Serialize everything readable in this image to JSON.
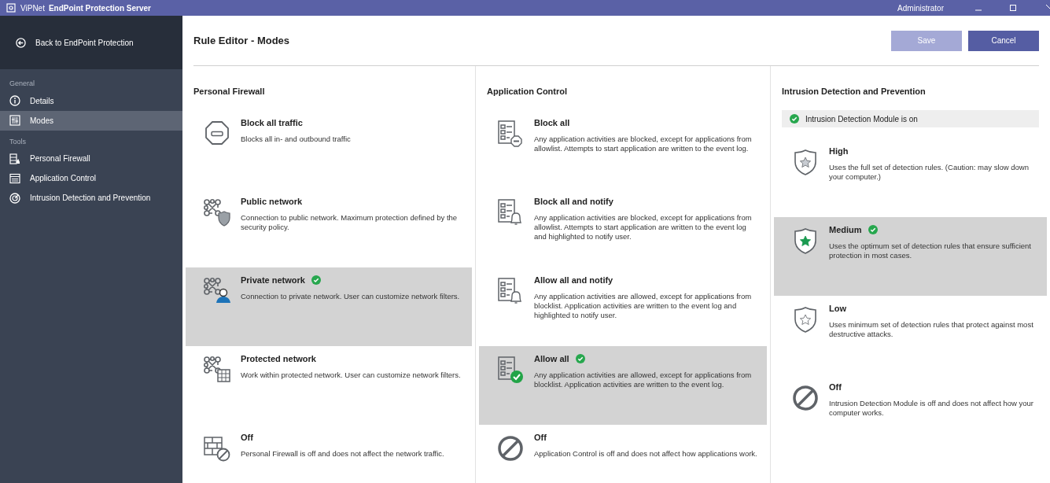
{
  "window": {
    "app": "ViPNet",
    "title": "EndPoint Protection Server",
    "user": "Administrator"
  },
  "sidebar": {
    "back": "Back to EndPoint Protection",
    "sections": [
      {
        "heading": "General",
        "items": [
          {
            "label": "Details",
            "selected": false
          },
          {
            "label": "Modes",
            "selected": true
          }
        ]
      },
      {
        "heading": "Tools",
        "items": [
          {
            "label": "Personal Firewall",
            "selected": false
          },
          {
            "label": "Application Control",
            "selected": false
          },
          {
            "label": "Intrusion Detection and Prevention",
            "selected": false
          }
        ]
      }
    ]
  },
  "header": {
    "title": "Rule Editor - Modes",
    "buttons": [
      {
        "label": "Save",
        "disabled": true
      },
      {
        "label": "Cancel",
        "disabled": false
      }
    ]
  },
  "columns": [
    {
      "title": "Personal Firewall",
      "options": [
        {
          "name": "Block all traffic",
          "description": "Blocks all in- and outbound traffic",
          "selected": false
        },
        {
          "name": "Public network",
          "description": "Connection to public network. Maximum protection defined by the security policy.",
          "selected": false
        },
        {
          "name": "Private network",
          "description": "Connection to private network. User can customize network filters.",
          "selected": true
        },
        {
          "name": "Protected network",
          "description": "Work within protected network. User can customize network filters.",
          "selected": false
        },
        {
          "name": "Off",
          "description": "Personal Firewall is off and does not affect the network traffic.",
          "selected": false
        }
      ]
    },
    {
      "title": "Application Control",
      "options": [
        {
          "name": "Block all",
          "description": "Any application activities are blocked, except for applications from allowlist. Attempts to start application are written to the event log.",
          "selected": false
        },
        {
          "name": "Block all and notify",
          "description": "Any application activities are blocked, except for applications from allowlist. Attempts to start application are written to the event log and highlighted to notify user.",
          "selected": false
        },
        {
          "name": "Allow all and notify",
          "description": "Any application activities are allowed, except for applications from blocklist. Application activities are written to the event log and highlighted to notify user.",
          "selected": false
        },
        {
          "name": "Allow all",
          "description": "Any application activities are allowed, except for applications from blocklist. Application activities are written to the event log.",
          "selected": true
        },
        {
          "name": "Off",
          "description": "Application Control is off and does not affect how applications work.",
          "selected": false
        }
      ]
    },
    {
      "title": "Intrusion Detection and Prevention",
      "status": "Intrusion Detection Module is on",
      "options": [
        {
          "name": "High",
          "description": "Uses the full set of detection rules. (Caution: may slow down your computer.)",
          "selected": false
        },
        {
          "name": "Medium",
          "description": "Uses the optimum set of detection rules that ensure sufficient protection in most cases.",
          "selected": true
        },
        {
          "name": "Low",
          "description": "Uses minimum set of detection rules that protect against most destructive attacks.",
          "selected": false
        },
        {
          "name": "Off",
          "description": "Intrusion Detection Module is off and does not affect how your computer works.",
          "selected": false
        }
      ]
    }
  ]
}
